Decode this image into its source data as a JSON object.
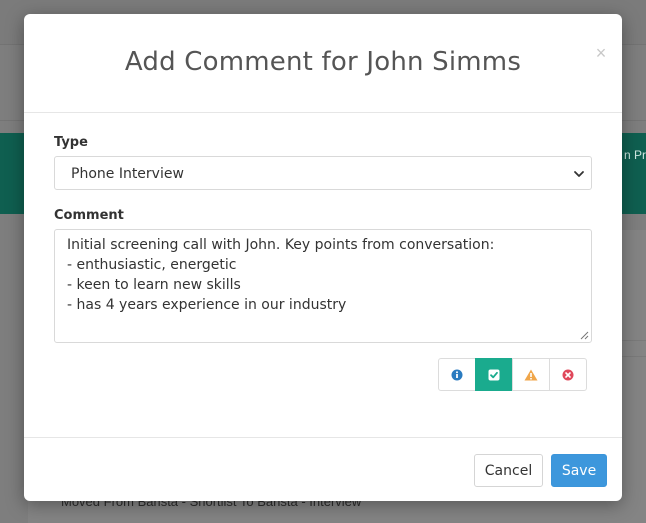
{
  "background": {
    "banner_text": "n Pr",
    "list_item_text": "Moved From Barista - Shortlist To Barista - Interview"
  },
  "modal": {
    "title": "Add Comment for John Simms",
    "close_symbol": "×",
    "type_label": "Type",
    "type_selected": "Phone Interview",
    "comment_label": "Comment",
    "comment_lines": [
      "Initial screening call with John. Key points from conversation:",
      "- enthusiastic, energetic",
      "- keen to learn new skills",
      "- has 4 years experience in our industry"
    ],
    "tone_buttons": [
      {
        "icon": "info-icon",
        "color": "#2a7bc0",
        "active": false
      },
      {
        "icon": "check-square-icon",
        "color": "#ffffff",
        "active": true
      },
      {
        "icon": "warning-icon",
        "color": "#f0a64a",
        "active": false
      },
      {
        "icon": "error-icon",
        "color": "#e0475a",
        "active": false
      }
    ],
    "cancel_label": "Cancel",
    "save_label": "Save"
  },
  "colors": {
    "accent_teal": "#1aab8e",
    "primary_blue": "#3d97dc"
  }
}
